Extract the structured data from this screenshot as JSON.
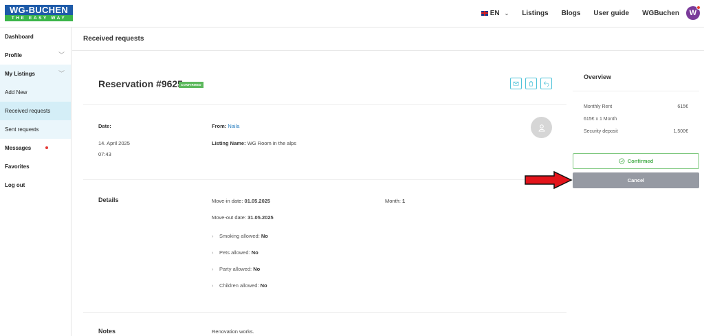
{
  "logo": {
    "top": "WG-BUCHEN",
    "tagline": "THE EASY WAY"
  },
  "header": {
    "language": "EN",
    "nav": [
      "Listings",
      "Blogs",
      "User guide",
      "WGBuchen"
    ],
    "avatar_initial": "W"
  },
  "sidebar": {
    "items": [
      {
        "label": "Dashboard"
      },
      {
        "label": "Profile"
      },
      {
        "label": "My Listings"
      },
      {
        "label": "Add New"
      },
      {
        "label": "Received requests"
      },
      {
        "label": "Sent requests"
      },
      {
        "label": "Messages"
      },
      {
        "label": "Favorites"
      },
      {
        "label": "Log out"
      }
    ]
  },
  "page": {
    "title": "Received requests"
  },
  "reservation": {
    "title": "Reservation #9625",
    "status_badge": "CONFIRMED",
    "date_label": "Date:",
    "date_value": "14. April 2025",
    "time_value": "07:43",
    "from_label": "From:",
    "from_value": "Naila",
    "listing_label": "Listing Name:",
    "listing_value": "WG Room in the alps"
  },
  "details": {
    "heading": "Details",
    "move_in_label": "Move-in date:",
    "move_in_value": "01.05.2025",
    "move_out_label": "Move-out date:",
    "move_out_value": "31.05.2025",
    "month_label": "Month:",
    "month_value": "1",
    "amenities": [
      {
        "label": "Smoking allowed:",
        "value": "No"
      },
      {
        "label": "Pets allowed:",
        "value": "No"
      },
      {
        "label": "Party allowed:",
        "value": "No"
      },
      {
        "label": "Children allowed:",
        "value": "No"
      }
    ]
  },
  "notes": {
    "heading": "Notes",
    "text": "Renovation works."
  },
  "overview": {
    "title": "Overview",
    "rows": [
      {
        "label": "Monthly Rent",
        "value": "615€"
      },
      {
        "label": "615€ x 1 Month",
        "value": ""
      },
      {
        "label": "Security deposit",
        "value": "1,500€"
      }
    ],
    "confirmed_label": "Confirmed",
    "cancel_label": "Cancel"
  },
  "colors": {
    "brand_blue": "#1d5aa8",
    "brand_green": "#3bb54a",
    "confirmed_green": "#4caf50",
    "cancel_gray": "#969aa3",
    "arrow_red": "#e3141b",
    "accent_cyan": "#4fc3d9"
  }
}
